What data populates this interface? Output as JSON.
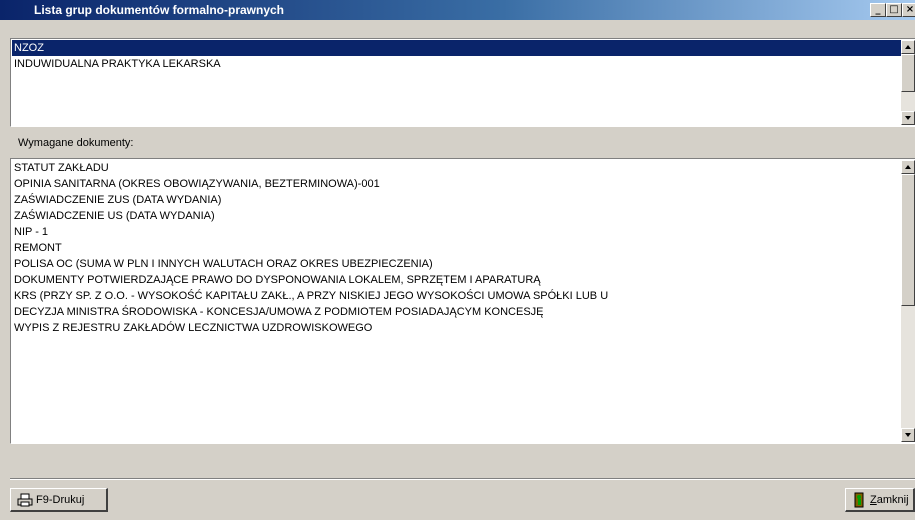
{
  "window": {
    "title": "Lista grup dokumentów formalno-prawnych",
    "buttons": {
      "minimize": "_",
      "maximize": "□",
      "close": "×"
    }
  },
  "groups": {
    "items": [
      "NZOZ",
      "INDUWIDUALNA PRAKTYKA LEKARSKA"
    ],
    "selected_index": 0
  },
  "documents": {
    "label": "Wymagane dokumenty:",
    "items": [
      "STATUT ZAKŁADU",
      "OPINIA SANITARNA (OKRES OBOWIĄZYWANIA, BEZTERMINOWA)-001",
      "ZAŚWIADCZENIE ZUS  (DATA WYDANIA)",
      "ZAŚWIADCZENIE US  (DATA WYDANIA)",
      "NIP - 1",
      "REMONT",
      "POLISA OC  (SUMA W PLN I INNYCH WALUTACH ORAZ OKRES UBEZPIECZENIA)",
      "DOKUMENTY POTWIERDZAJĄCE PRAWO DO DYSPONOWANIA LOKALEM, SPRZĘTEM I APARATURĄ",
      "KRS (PRZY SP. Z O.O. - WYSOKOŚĆ KAPITAŁU ZAKŁ., A PRZY NISKIEJ JEGO WYSOKOŚCI UMOWA SPÓŁKI LUB U",
      "DECYZJA MINISTRA ŚRODOWISKA - KONCESJA/UMOWA Z PODMIOTEM POSIADAJĄCYM KONCESJĘ",
      "WYPIS Z REJESTRU ZAKŁADÓW LECZNICTWA UZDROWISKOWEGO"
    ]
  },
  "footer": {
    "print_label": "F9-Drukuj",
    "close_label_underlined": "Z",
    "close_label_rest": "amknij"
  },
  "icons": {
    "print": "printer-icon",
    "close": "exit-person-icon"
  },
  "colors": {
    "selection": "#0a246a",
    "title_gradient_start": "#0a246a",
    "title_gradient_end": "#a6caf0",
    "face": "#d4d0c8"
  }
}
